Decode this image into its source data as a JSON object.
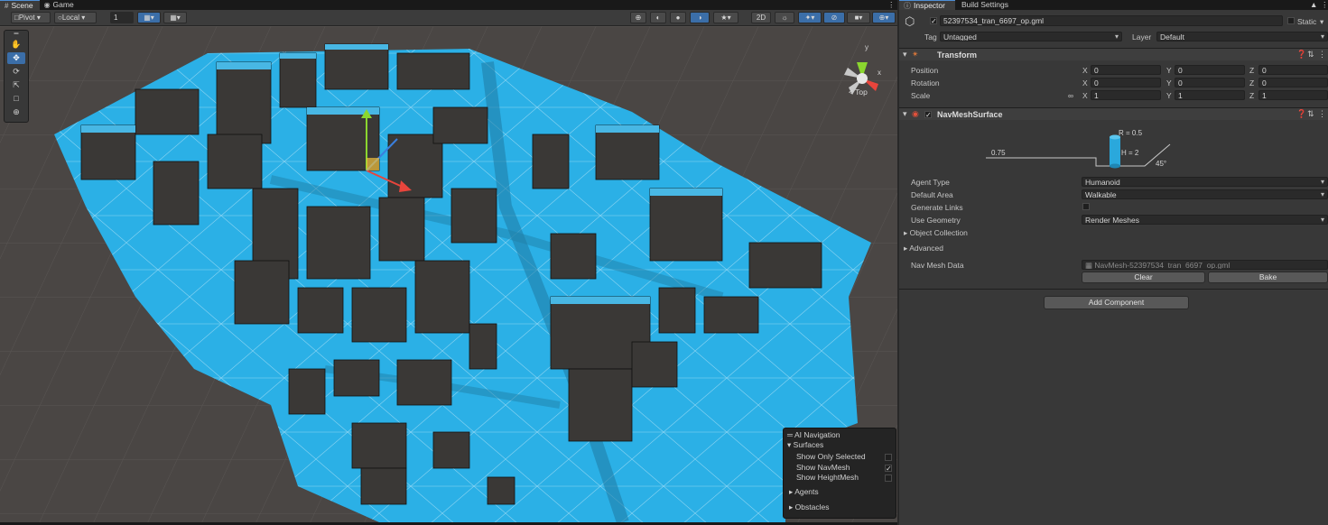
{
  "scene": {
    "tabs": [
      {
        "label": "Scene",
        "icon": "hash-icon"
      },
      {
        "label": "Game",
        "icon": "gamepad-icon"
      }
    ],
    "toolbar": {
      "pivot": "Pivot",
      "local": "Local",
      "grid_snap_value": "1",
      "mode_2d": "2D"
    },
    "gizmo_label": "< Top",
    "overlay": {
      "title": "AI Navigation",
      "surfaces_label": "Surfaces",
      "options": [
        {
          "label": "Show Only Selected",
          "checked": false
        },
        {
          "label": "Show NavMesh",
          "checked": true
        },
        {
          "label": "Show HeightMesh",
          "checked": false
        }
      ],
      "agents_label": "Agents",
      "obstacles_label": "Obstacles"
    }
  },
  "inspector": {
    "tabs": [
      "Inspector",
      "Build Settings"
    ],
    "object_name": "52397534_tran_6697_op.gml",
    "static_label": "Static",
    "tag_label": "Tag",
    "tag_value": "Untagged",
    "layer_label": "Layer",
    "layer_value": "Default",
    "transform": {
      "title": "Transform",
      "rows": [
        {
          "label": "Position",
          "x": "0",
          "y": "0",
          "z": "0"
        },
        {
          "label": "Rotation",
          "x": "0",
          "y": "0",
          "z": "0"
        },
        {
          "label": "Scale",
          "x": "1",
          "y": "1",
          "z": "1"
        }
      ]
    },
    "navmesh_surface": {
      "title": "NavMeshSurface",
      "diagram": {
        "radius": "R = 0.5",
        "height": "H = 2",
        "step": "0.75",
        "slope": "45°"
      },
      "agent_type_label": "Agent Type",
      "agent_type_value": "Humanoid",
      "default_area_label": "Default Area",
      "default_area_value": "Walkable",
      "generate_links_label": "Generate Links",
      "use_geometry_label": "Use Geometry",
      "use_geometry_value": "Render Meshes",
      "object_collection_label": "Object Collection",
      "advanced_label": "Advanced",
      "nav_mesh_data_label": "Nav Mesh Data",
      "nav_mesh_data_value": "NavMesh-52397534_tran_6697_op.gml",
      "clear_label": "Clear",
      "bake_label": "Bake"
    },
    "add_component_label": "Add Component"
  },
  "colors": {
    "navmesh": "#2bb0e6",
    "accent_blue": "#3b6ea8",
    "panel": "#383838"
  }
}
